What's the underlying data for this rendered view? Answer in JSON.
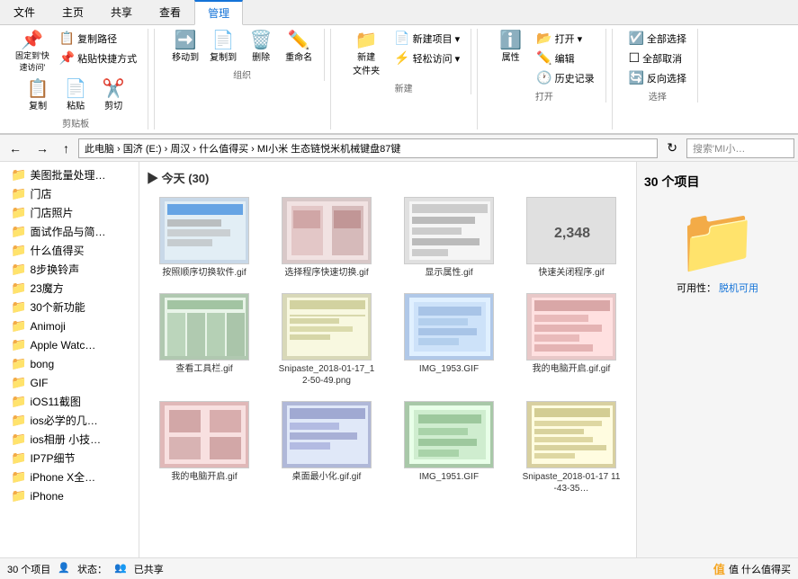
{
  "tabs": [
    {
      "label": "文件",
      "active": false
    },
    {
      "label": "主页",
      "active": false
    },
    {
      "label": "共享",
      "active": false
    },
    {
      "label": "查看",
      "active": false
    },
    {
      "label": "管理",
      "active": true
    }
  ],
  "ribbon": {
    "groups": [
      {
        "label": "剪贴板",
        "buttons": [
          {
            "icon": "📌",
            "label": "固定到'快\n速访问'"
          },
          {
            "icon": "📋",
            "label": "复制"
          },
          {
            "icon": "📄",
            "label": "粘贴"
          },
          {
            "icon": "✂️",
            "label": "剪切"
          }
        ],
        "small_buttons": [
          {
            "icon": "📋",
            "label": "复制路径"
          },
          {
            "icon": "📌",
            "label": "粘贴快捷方式"
          }
        ]
      },
      {
        "label": "组织",
        "buttons": [
          {
            "icon": "➡️",
            "label": "移动到"
          },
          {
            "icon": "📄",
            "label": "复制到"
          },
          {
            "icon": "🗑️",
            "label": "删除"
          },
          {
            "icon": "✏️",
            "label": "重命名"
          }
        ]
      },
      {
        "label": "新建",
        "buttons": [
          {
            "icon": "📁",
            "label": "新建\n文件夹"
          }
        ],
        "small_buttons": [
          {
            "icon": "📄",
            "label": "新建项目 ▾"
          },
          {
            "icon": "⚡",
            "label": "轻松访问 ▾"
          }
        ]
      },
      {
        "label": "打开",
        "buttons": [
          {
            "icon": "ℹ️",
            "label": "属性"
          }
        ],
        "small_buttons": [
          {
            "icon": "📂",
            "label": "打开 ▾"
          },
          {
            "icon": "✏️",
            "label": "编辑"
          },
          {
            "icon": "🕐",
            "label": "历史记录"
          }
        ]
      },
      {
        "label": "选择",
        "small_buttons": [
          {
            "icon": "☑️",
            "label": "全部选择"
          },
          {
            "icon": "☐",
            "label": "全部取消"
          },
          {
            "icon": "🔄",
            "label": "反向选择"
          }
        ]
      }
    ]
  },
  "addressbar": {
    "back": "←",
    "forward": "→",
    "up": "↑",
    "path": "此电脑 › 国济 (E:) › 周汉 › 什么值得买 › MI小米 生态链悦米机械键盘87键",
    "search_placeholder": "搜索'MI小…"
  },
  "sidebar": {
    "items": [
      {
        "label": "美图批量处理…",
        "icon": "📁"
      },
      {
        "label": "门店",
        "icon": "📁"
      },
      {
        "label": "门店照片",
        "icon": "📁"
      },
      {
        "label": "面试作品与简…",
        "icon": "📁"
      },
      {
        "label": "什么值得买",
        "icon": "📁"
      },
      {
        "label": "8步换铃声",
        "icon": "📁"
      },
      {
        "label": "23魔方",
        "icon": "📁"
      },
      {
        "label": "30个新功能",
        "icon": "📁"
      },
      {
        "label": "Animoji",
        "icon": "📁"
      },
      {
        "label": "Apple Watc…",
        "icon": "📁"
      },
      {
        "label": "bong",
        "icon": "📁"
      },
      {
        "label": "GIF",
        "icon": "📁"
      },
      {
        "label": "iOS11截图",
        "icon": "📁"
      },
      {
        "label": "ios必学的几…",
        "icon": "📁"
      },
      {
        "label": "ios相册 小技…",
        "icon": "📁"
      },
      {
        "label": "IP7P细节",
        "icon": "📁"
      },
      {
        "label": "iPhone X全…",
        "icon": "📁"
      },
      {
        "label": "iPhone",
        "icon": "📁"
      }
    ]
  },
  "filelist": {
    "header": "今天 (30)",
    "items": [
      {
        "name": "按照顺序切换软件.gif",
        "thumb_class": "thumb-1"
      },
      {
        "name": "选择程序快速切换.gif",
        "thumb_class": "thumb-2"
      },
      {
        "name": "显示属性.gif",
        "thumb_class": "thumb-3"
      },
      {
        "name": "快速关闭程序.gif",
        "thumb_class": "thumb-4",
        "text": "2,348"
      },
      {
        "name": "查看工具栏.gif",
        "thumb_class": "thumb-5"
      },
      {
        "name": "Snipaste_2018-01-17_12-50-49.png",
        "thumb_class": "thumb-6"
      },
      {
        "name": "IMG_1953.GIF",
        "thumb_class": "thumb-7"
      },
      {
        "name": "我的电脑开启.gif.gif",
        "thumb_class": "thumb-8"
      },
      {
        "name": "我的电脑开启.gif",
        "thumb_class": "thumb-9"
      },
      {
        "name": "桌面最小化.gif.gif",
        "thumb_class": "thumb-10"
      },
      {
        "name": "IMG_1951.GIF",
        "thumb_class": "thumb-11"
      },
      {
        "name": "Snipaste_2018-01-17 11-43-35…",
        "thumb_class": "thumb-12"
      }
    ]
  },
  "rightpanel": {
    "count": "30 个项目",
    "availability_label": "可用性：",
    "availability_value": "脱机可用"
  },
  "statusbar": {
    "count": "30 个项目",
    "state_icon": "👤",
    "state_label": "状态：",
    "share_icon": "👥",
    "share_label": "已共享",
    "watermark": "值 什么值得买"
  }
}
